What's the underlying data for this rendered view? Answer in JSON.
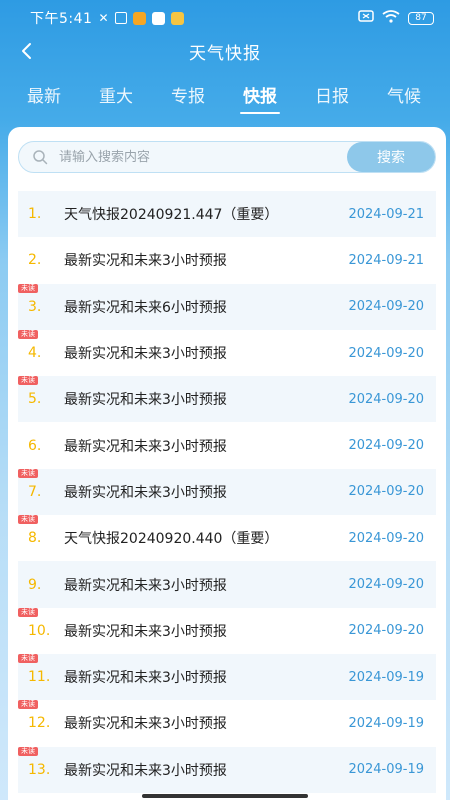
{
  "status_bar": {
    "time": "下午5:41",
    "battery": "87"
  },
  "header": {
    "title": "天气快报"
  },
  "tabs": [
    {
      "label": "最新",
      "active": false
    },
    {
      "label": "重大",
      "active": false
    },
    {
      "label": "专报",
      "active": false
    },
    {
      "label": "快报",
      "active": true
    },
    {
      "label": "日报",
      "active": false
    },
    {
      "label": "气候",
      "active": false
    }
  ],
  "search": {
    "placeholder": "请输入搜索内容",
    "button_label": "搜索"
  },
  "unread_label": "未读",
  "items": [
    {
      "num": "1.",
      "title": "天气快报20240921.447（重要）",
      "date": "2024-09-21",
      "unread": false
    },
    {
      "num": "2.",
      "title": "最新实况和未来3小时预报",
      "date": "2024-09-21",
      "unread": false
    },
    {
      "num": "3.",
      "title": "最新实况和未来6小时预报",
      "date": "2024-09-20",
      "unread": true
    },
    {
      "num": "4.",
      "title": "最新实况和未来3小时预报",
      "date": "2024-09-20",
      "unread": true
    },
    {
      "num": "5.",
      "title": "最新实况和未来3小时预报",
      "date": "2024-09-20",
      "unread": true
    },
    {
      "num": "6.",
      "title": "最新实况和未来3小时预报",
      "date": "2024-09-20",
      "unread": false
    },
    {
      "num": "7.",
      "title": "最新实况和未来3小时预报",
      "date": "2024-09-20",
      "unread": true
    },
    {
      "num": "8.",
      "title": "天气快报20240920.440（重要）",
      "date": "2024-09-20",
      "unread": true
    },
    {
      "num": "9.",
      "title": "最新实况和未来3小时预报",
      "date": "2024-09-20",
      "unread": false
    },
    {
      "num": "10.",
      "title": "最新实况和未来3小时预报",
      "date": "2024-09-20",
      "unread": true
    },
    {
      "num": "11.",
      "title": "最新实况和未来3小时预报",
      "date": "2024-09-19",
      "unread": true
    },
    {
      "num": "12.",
      "title": "最新实况和未来3小时预报",
      "date": "2024-09-19",
      "unread": true
    },
    {
      "num": "13.",
      "title": "最新实况和未来3小时预报",
      "date": "2024-09-19",
      "unread": true
    }
  ]
}
